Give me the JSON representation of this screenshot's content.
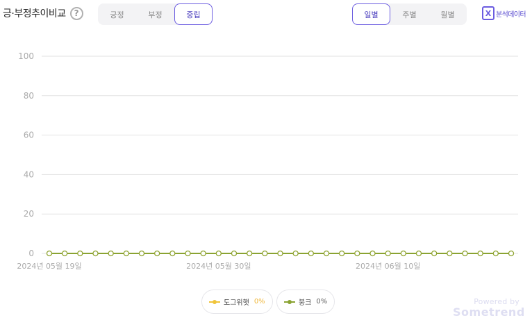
{
  "header": {
    "title": "긍·부정추이비교",
    "help_icon": "?",
    "sentiment_tabs": [
      {
        "label": "긍정",
        "active": false
      },
      {
        "label": "부정",
        "active": false
      },
      {
        "label": "중립",
        "active": true
      }
    ],
    "period_tabs": [
      {
        "label": "일별",
        "active": true
      },
      {
        "label": "주별",
        "active": false
      },
      {
        "label": "월별",
        "active": false
      }
    ],
    "export_label": "분석데이터",
    "export_icon": "X"
  },
  "colors": {
    "accent": "#6b5ce0",
    "series1": "#f0c43a",
    "series2": "#8aa332",
    "grid": "#e2e2e2"
  },
  "chart_data": {
    "type": "line",
    "ylim": [
      0,
      100
    ],
    "yticks": [
      0,
      20,
      40,
      60,
      80,
      100
    ],
    "x_tick_labels": [
      "2024년 05월 19일",
      "2024년 05월 30일",
      "2024년 06월 10일"
    ],
    "x_tick_indices": [
      0,
      11,
      22
    ],
    "point_count": 31,
    "grid": true,
    "legend_position": "bottom",
    "series": [
      {
        "name": "도그위햇",
        "percent_label": "0%",
        "color": "#f0c43a",
        "values": [
          0,
          0,
          0,
          0,
          0,
          0,
          0,
          0,
          0,
          0,
          0,
          0,
          0,
          0,
          0,
          0,
          0,
          0,
          0,
          0,
          0,
          0,
          0,
          0,
          0,
          0,
          0,
          0,
          0,
          0,
          0
        ]
      },
      {
        "name": "붕크",
        "percent_label": "0%",
        "color": "#8aa332",
        "values": [
          0,
          0,
          0,
          0,
          0,
          0,
          0,
          0,
          0,
          0,
          0,
          0,
          0,
          0,
          0,
          0,
          0,
          0,
          0,
          0,
          0,
          0,
          0,
          0,
          0,
          0,
          0,
          0,
          0,
          0,
          0
        ]
      }
    ]
  },
  "brand": {
    "powered_by": "Powered by",
    "name": "Sometrend"
  }
}
